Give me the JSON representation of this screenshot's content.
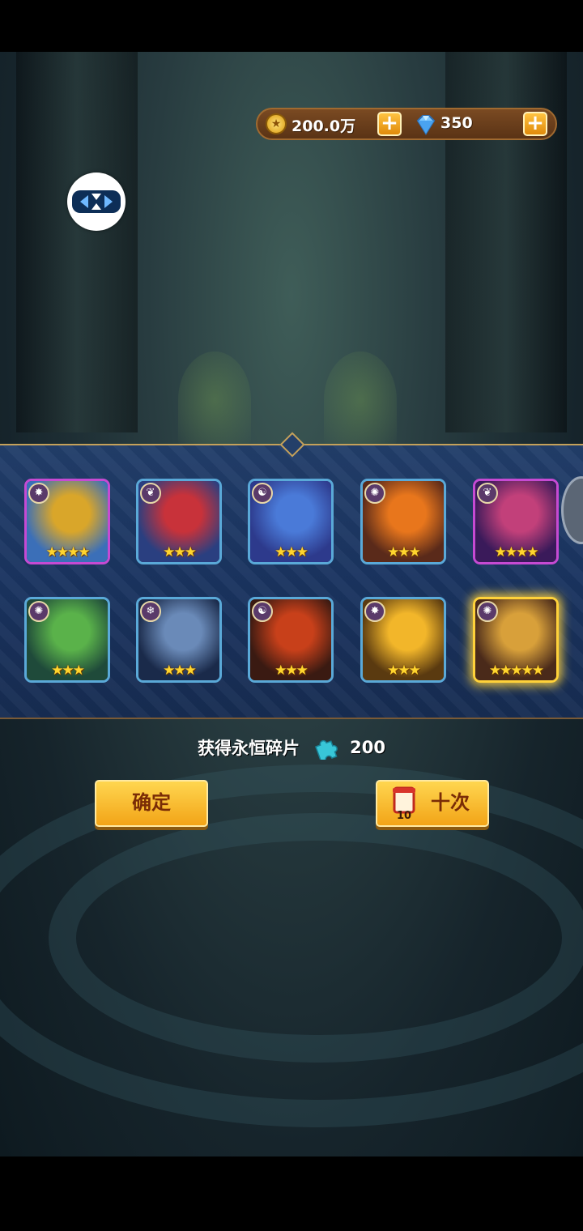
{
  "currency": {
    "gold": "200.0万",
    "gems": "350",
    "add_label": "+"
  },
  "summon": {
    "heroes": [
      {
        "element": "✸",
        "stars": "★★★★",
        "frame": "purple"
      },
      {
        "element": "❦",
        "stars": "★★★",
        "frame": "blue"
      },
      {
        "element": "☯",
        "stars": "★★★",
        "frame": "blue"
      },
      {
        "element": "✺",
        "stars": "★★★",
        "frame": "blue"
      },
      {
        "element": "❦",
        "stars": "★★★★",
        "frame": "purple"
      },
      {
        "element": "✺",
        "stars": "★★★",
        "frame": "blue"
      },
      {
        "element": "❄",
        "stars": "★★★",
        "frame": "blue"
      },
      {
        "element": "☯",
        "stars": "★★★",
        "frame": "blue"
      },
      {
        "element": "✸",
        "stars": "★★★",
        "frame": "blue"
      },
      {
        "element": "✺",
        "stars": "★★★★★",
        "frame": "gold"
      }
    ]
  },
  "reward": {
    "label": "获得永恒碎片",
    "amount": "200"
  },
  "buttons": {
    "confirm": "确定",
    "ten_pull": "十次",
    "ten_pull_badge": "10"
  },
  "colors": {
    "accent_gold": "#f2a417",
    "panel_blue": "#1a3460",
    "frame_purple": "#c64ad3",
    "frame_blue": "#5aa9d8"
  }
}
